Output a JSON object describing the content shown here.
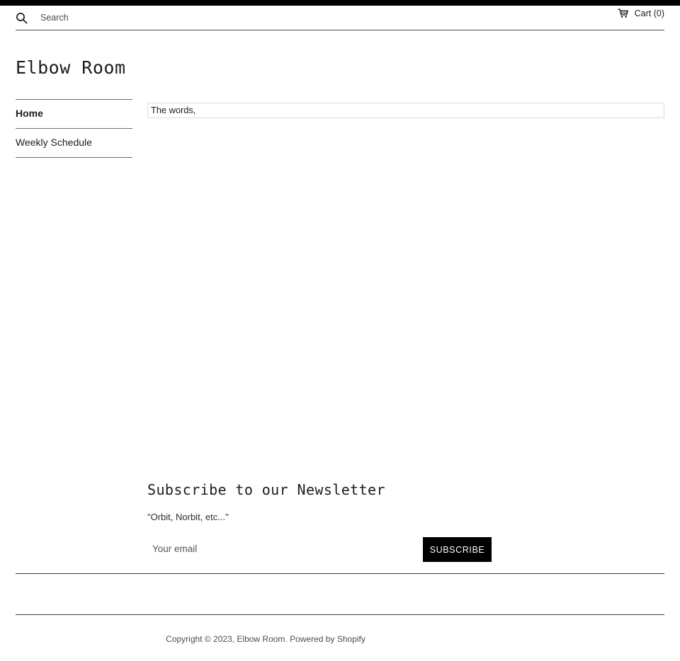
{
  "header": {
    "search": {
      "icon": "search-icon",
      "placeholder": "Search",
      "value": ""
    },
    "cart": {
      "icon": "shopping-cart-icon",
      "label": "Cart (0)"
    }
  },
  "site": {
    "title": "Elbow Room"
  },
  "sidebar": {
    "items": [
      {
        "label": "Home",
        "active": true
      },
      {
        "label": "Weekly Schedule",
        "active": false
      }
    ]
  },
  "main": {
    "body_text": "The words,"
  },
  "newsletter": {
    "title": "Subscribe to our Newsletter",
    "subtitle": "\"Orbit, Norbit, etc...\"",
    "email_placeholder": "Your email",
    "email_value": "",
    "subscribe_label": "SUBSCRIBE"
  },
  "footer": {
    "copyright": "Copyright © 2023, Elbow Room. Powered by Shopify"
  },
  "colors": {
    "accent": "#000000",
    "text": "#1c1d1d",
    "rule": "#4a4a4a",
    "box_border": "#dcdcdc"
  }
}
